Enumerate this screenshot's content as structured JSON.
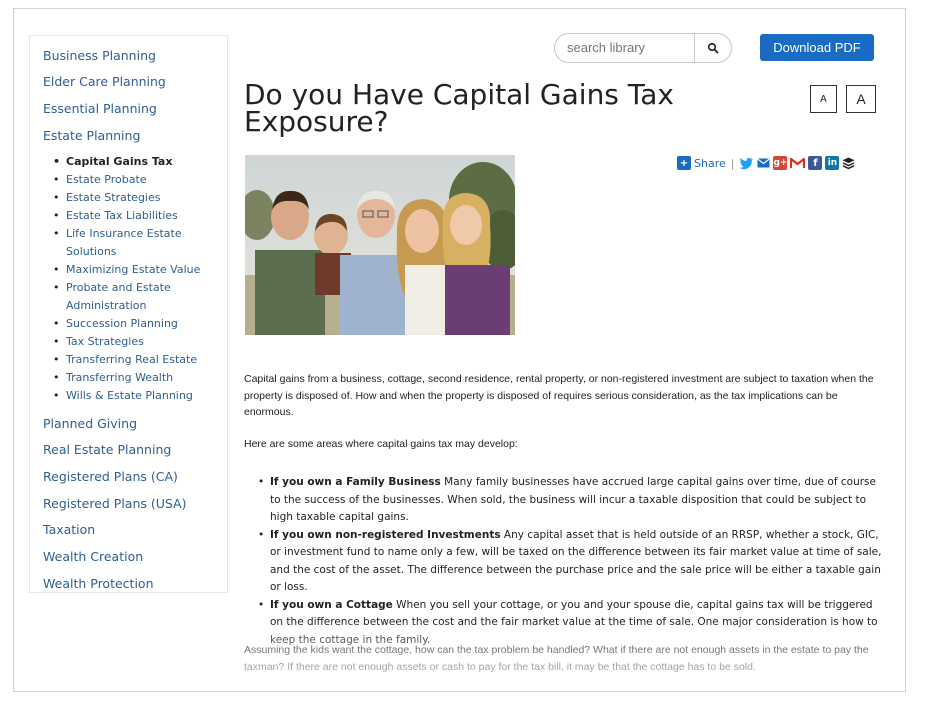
{
  "sidebar": {
    "top_items": [
      {
        "label": "Business Planning"
      },
      {
        "label": "Elder Care Planning"
      },
      {
        "label": "Essential Planning"
      },
      {
        "label": "Estate Planning"
      }
    ],
    "sub_items": [
      {
        "label": "Capital Gains Tax",
        "active": true
      },
      {
        "label": "Estate Probate"
      },
      {
        "label": "Estate Strategies"
      },
      {
        "label": "Estate Tax Liabilities"
      },
      {
        "label": "Life Insurance Estate Solutions"
      },
      {
        "label": "Maximizing Estate Value"
      },
      {
        "label": "Probate and Estate Administration"
      },
      {
        "label": "Succession Planning"
      },
      {
        "label": "Tax Strategies"
      },
      {
        "label": "Transferring Real Estate"
      },
      {
        "label": "Transferring Wealth"
      },
      {
        "label": "Wills & Estate Planning"
      }
    ],
    "bottom_items": [
      {
        "label": "Planned Giving"
      },
      {
        "label": "Real Estate Planning"
      },
      {
        "label": "Registered Plans (CA)"
      },
      {
        "label": "Registered Plans (USA)"
      },
      {
        "label": "Taxation"
      },
      {
        "label": "Wealth Creation"
      },
      {
        "label": "Wealth Protection"
      }
    ]
  },
  "search": {
    "placeholder": "search library",
    "icon": "search-icon"
  },
  "download_button": {
    "label": "Download PDF"
  },
  "page_title": "Do you Have Capital Gains Tax Exposure?",
  "font_size_controls": {
    "small": "A",
    "large": "A"
  },
  "share": {
    "label": "Share",
    "separator": "|",
    "icons": [
      "twitter-icon",
      "email-icon",
      "google-plus-icon",
      "gmail-icon",
      "facebook-icon",
      "linkedin-icon",
      "buffer-icon"
    ]
  },
  "article": {
    "intro": "Capital gains from a business, cottage, second residence, rental property, or non-registered investment are subject to taxation when the property is disposed of.  How and when the property is disposed of requires serious consideration, as the tax implications can be enormous.",
    "lead": "Here are some areas where capital gains tax may develop:",
    "bullets": [
      {
        "bold": "If you own a Family Business",
        "text": " Many family businesses have accrued large capital gains over time, due of course to the success of the businesses.  When sold, the business will incur a taxable disposition that could be subject to high taxable capital gains."
      },
      {
        "bold": "If you own non-registered Investments",
        "text": " Any capital asset that is held outside of an RRSP, whether a stock, GIC, or investment fund to name only a few, will be taxed on the difference between its fair market value at time of sale, and the cost of the asset.  The difference between the purchase price and the sale price will be either a taxable gain or loss."
      },
      {
        "bold": "If you own a Cottage",
        "text": " When you sell your cottage, or you and your spouse die, capital gains tax will be triggered on the difference between the cost and the fair market value at the time of sale. One major consideration is how to keep the cottage in the family."
      }
    ],
    "closing": "Assuming the kids want the cottage, how can the tax problem be handled?  What if there are not enough assets in the estate to pay the taxman?  If there are not enough assets or cash to pay for the tax bill, it may be that the cottage has to be sold."
  },
  "colors": {
    "link": "#2f5e8f",
    "accent": "#1a6bc4",
    "text": "#222222"
  }
}
